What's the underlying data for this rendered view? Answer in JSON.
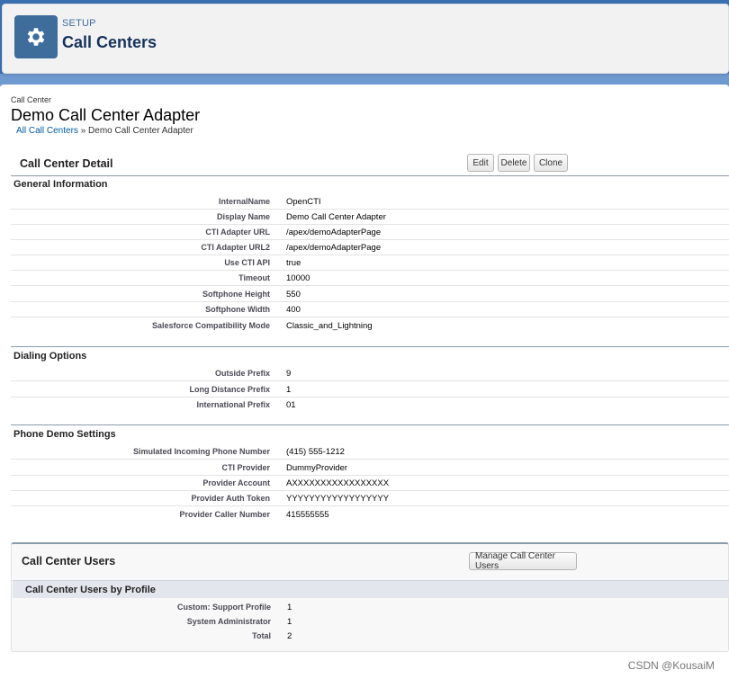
{
  "header": {
    "setup_label": "SETUP",
    "page_title": "Call Centers",
    "icon": "gear-icon",
    "icon_bg": "#3e6d9b"
  },
  "record": {
    "type_label": "Call Center",
    "name": "Demo Call Center Adapter",
    "breadcrumb": {
      "link": "All Call Centers",
      "separator": "»",
      "current": "Demo Call Center Adapter"
    }
  },
  "detail": {
    "title": "Call Center Detail",
    "buttons": {
      "edit": "Edit",
      "delete": "Delete",
      "clone": "Clone"
    }
  },
  "sections": {
    "general": {
      "title": "General Information",
      "rows": [
        {
          "label": "InternalName",
          "value": "OpenCTI"
        },
        {
          "label": "Display Name",
          "value": "Demo Call Center Adapter"
        },
        {
          "label": "CTI Adapter URL",
          "value": "/apex/demoAdapterPage"
        },
        {
          "label": "CTI Adapter URL2",
          "value": "/apex/demoAdapterPage"
        },
        {
          "label": "Use CTI API",
          "value": "true"
        },
        {
          "label": "Timeout",
          "value": "10000"
        },
        {
          "label": "Softphone Height",
          "value": "550"
        },
        {
          "label": "Softphone Width",
          "value": "400"
        },
        {
          "label": "Salesforce Compatibility Mode",
          "value": "Classic_and_Lightning"
        }
      ]
    },
    "dialing": {
      "title": "Dialing Options",
      "rows": [
        {
          "label": "Outside Prefix",
          "value": "9"
        },
        {
          "label": "Long Distance Prefix",
          "value": "1"
        },
        {
          "label": "International Prefix",
          "value": "01"
        }
      ]
    },
    "phone_demo": {
      "title": "Phone Demo Settings",
      "rows": [
        {
          "label": "Simulated Incoming Phone Number",
          "value": "(415) 555-1212"
        },
        {
          "label": "CTI Provider",
          "value": "DummyProvider"
        },
        {
          "label": "Provider Account",
          "value": "AXXXXXXXXXXXXXXXXX"
        },
        {
          "label": "Provider Auth Token",
          "value": "YYYYYYYYYYYYYYYYYY"
        },
        {
          "label": "Provider Caller Number",
          "value": "415555555"
        }
      ]
    }
  },
  "users": {
    "title": "Call Center Users",
    "manage_button": "Manage Call Center Users",
    "subsection_title": "Call Center Users by Profile",
    "rows": [
      {
        "label": "Custom: Support Profile",
        "value": "1"
      },
      {
        "label": "System Administrator",
        "value": "1"
      },
      {
        "label": "Total",
        "value": "2"
      }
    ]
  },
  "watermark": "CSDN @KousaiM"
}
